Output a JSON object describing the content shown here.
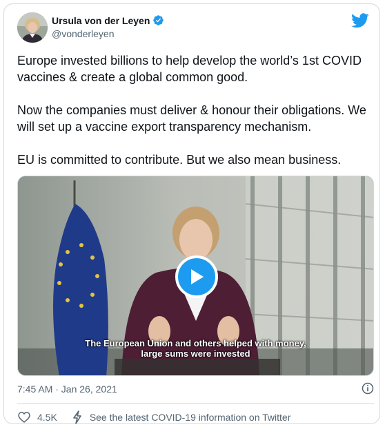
{
  "author": {
    "display_name": "Ursula von der Leyen",
    "handle": "@vonderleyen",
    "verified": true
  },
  "tweet": {
    "paragraphs": [
      "Europe invested billions to help develop the world’s 1st COVID vaccines & create a global common good.",
      "Now the companies must deliver & honour their obligations. We will set up a vaccine export transparency mechanism.",
      "EU is committed to contribute. But we also mean business."
    ]
  },
  "media": {
    "caption_line1": "The European Union and others helped with money,",
    "caption_line2": "large sums were invested"
  },
  "timestamp": "7:45 AM · Jan 26, 2021",
  "actions": {
    "like_count": "4.5K",
    "covid_link": "See the latest COVID-19 information on Twitter"
  },
  "colors": {
    "accent": "#1d9bf0",
    "text_primary": "#0f1419",
    "text_secondary": "#536471",
    "border": "#cfd9de"
  },
  "icons": {
    "brand": "twitter-bird-icon",
    "verified": "verified-badge-icon",
    "play": "play-icon",
    "info": "info-icon",
    "like": "heart-icon",
    "covid": "lightning-icon"
  }
}
